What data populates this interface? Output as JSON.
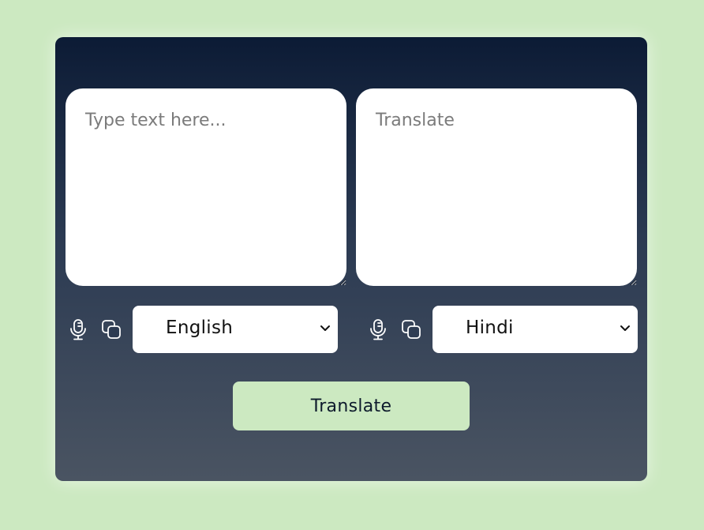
{
  "source": {
    "placeholder": "Type text here...",
    "value": "",
    "language": "English",
    "mic_icon": "microphone-icon",
    "copy_icon": "copy-icon"
  },
  "target": {
    "placeholder": "Translate",
    "value": "",
    "language": "Hindi",
    "mic_icon": "microphone-icon",
    "copy_icon": "copy-icon"
  },
  "actions": {
    "translate_label": "Translate"
  },
  "colors": {
    "page_background": "#cce9c1",
    "card_gradient_top": "#0c1b35",
    "card_gradient_bottom": "#4a5462",
    "button_background": "#cce9c1"
  }
}
